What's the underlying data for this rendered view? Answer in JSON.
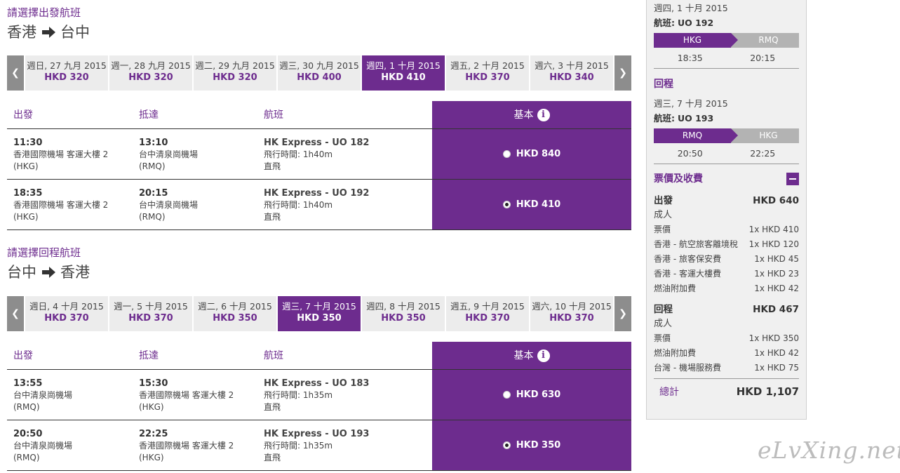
{
  "outbound": {
    "title": "請選擇出發航班",
    "from": "香港",
    "to": "台中",
    "dates": [
      {
        "date": "週日, 27 九月 2015",
        "price": "HKD 320"
      },
      {
        "date": "週一, 28 九月 2015",
        "price": "HKD 320"
      },
      {
        "date": "週二, 29 九月 2015",
        "price": "HKD 320"
      },
      {
        "date": "週三, 30 九月 2015",
        "price": "HKD 400"
      },
      {
        "date": "週四, 1 十月 2015",
        "price": "HKD 410"
      },
      {
        "date": "週五, 2 十月 2015",
        "price": "HKD 370"
      },
      {
        "date": "週六, 3 十月 2015",
        "price": "HKD 340"
      }
    ],
    "selected_date_index": 4,
    "headers": {
      "depart": "出發",
      "arrive": "抵達",
      "flight": "航班",
      "fare": "基本"
    },
    "flights": [
      {
        "dep_time": "11:30",
        "dep_airport": "香港國際機場 客運大樓 2",
        "dep_code": "(HKG)",
        "arr_time": "13:10",
        "arr_airport": "台中清泉崗機場",
        "arr_code": "(RMQ)",
        "flight": "HK Express - UO 182",
        "duration": "飛行時間: 1h40m",
        "type": "直飛",
        "price": "HKD 840",
        "selected": false
      },
      {
        "dep_time": "18:35",
        "dep_airport": "香港國際機場 客運大樓 2",
        "dep_code": "(HKG)",
        "arr_time": "20:15",
        "arr_airport": "台中清泉崗機場",
        "arr_code": "(RMQ)",
        "flight": "HK Express - UO 192",
        "duration": "飛行時間: 1h40m",
        "type": "直飛",
        "price": "HKD 410",
        "selected": true
      }
    ]
  },
  "inbound": {
    "title": "請選擇回程航班",
    "from": "台中",
    "to": "香港",
    "dates": [
      {
        "date": "週日, 4 十月 2015",
        "price": "HKD 370"
      },
      {
        "date": "週一, 5 十月 2015",
        "price": "HKD 370"
      },
      {
        "date": "週二, 6 十月 2015",
        "price": "HKD 350"
      },
      {
        "date": "週三, 7 十月 2015",
        "price": "HKD 350"
      },
      {
        "date": "週四, 8 十月 2015",
        "price": "HKD 350"
      },
      {
        "date": "週五, 9 十月 2015",
        "price": "HKD 370"
      },
      {
        "date": "週六, 10 十月 2015",
        "price": "HKD 370"
      }
    ],
    "selected_date_index": 3,
    "headers": {
      "depart": "出發",
      "arrive": "抵達",
      "flight": "航班",
      "fare": "基本"
    },
    "flights": [
      {
        "dep_time": "13:55",
        "dep_airport": "台中清泉崗機場",
        "dep_code": "(RMQ)",
        "arr_time": "15:30",
        "arr_airport": "香港國際機場 客運大樓 2",
        "arr_code": "(HKG)",
        "flight": "HK Express - UO 183",
        "duration": "飛行時間: 1h35m",
        "type": "直飛",
        "price": "HKD 630",
        "selected": false
      },
      {
        "dep_time": "20:50",
        "dep_airport": "台中清泉崗機場",
        "dep_code": "(RMQ)",
        "arr_time": "22:25",
        "arr_airport": "香港國際機場 客運大樓 2",
        "arr_code": "(HKG)",
        "flight": "HK Express - UO 193",
        "duration": "飛行時間: 1h35m",
        "type": "直飛",
        "price": "HKD 350",
        "selected": true
      }
    ]
  },
  "summary": {
    "outbound": {
      "date": "週四, 1 十月 2015",
      "flight_label": "航班:",
      "flight_no": "UO 192",
      "from": "HKG",
      "to": "RMQ",
      "dep_time": "18:35",
      "arr_time": "20:15"
    },
    "return_title": "回程",
    "inbound": {
      "date": "週三, 7 十月 2015",
      "flight_label": "航班:",
      "flight_no": "UO 193",
      "from": "RMQ",
      "to": "HKG",
      "dep_time": "20:50",
      "arr_time": "22:25"
    },
    "fees_title": "票價及收費",
    "out_fees": {
      "title": "出發",
      "total": "HKD 640",
      "adult": "成人",
      "items": [
        {
          "name": "票價",
          "value": "1x HKD 410"
        },
        {
          "name": "香港 - 航空旅客離境稅",
          "value": "1x HKD 120"
        },
        {
          "name": "香港 - 旅客保安費",
          "value": "1x HKD 45"
        },
        {
          "name": "香港 - 客運大樓費",
          "value": "1x HKD 23"
        },
        {
          "name": "燃油附加費",
          "value": "1x HKD 42"
        }
      ]
    },
    "in_fees": {
      "title": "回程",
      "total": "HKD 467",
      "adult": "成人",
      "items": [
        {
          "name": "票價",
          "value": "1x HKD 350"
        },
        {
          "name": "燃油附加費",
          "value": "1x HKD 42"
        },
        {
          "name": "台灣 - 機場服務費",
          "value": "1x HKD 75"
        }
      ]
    },
    "grand_total_label": "總計",
    "grand_total": "HKD 1,107"
  },
  "watermark": "eLvXing.net",
  "icons": {
    "arrow": "arrow-right-icon",
    "prev": "chevron-left-icon",
    "next": "chevron-right-icon",
    "info": "info-icon",
    "collapse": "minus-icon"
  },
  "colors": {
    "brand": "#6d2c8e",
    "inactive_leg": "#b3b3b3"
  }
}
